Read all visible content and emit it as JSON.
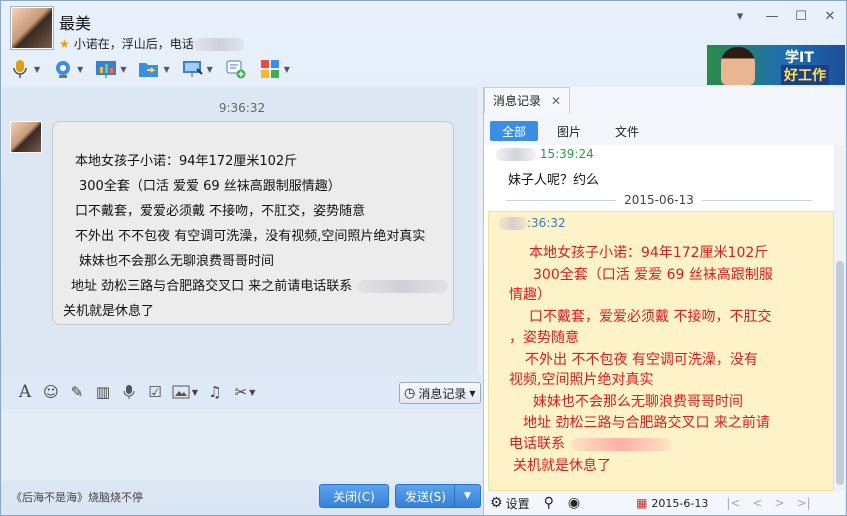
{
  "header": {
    "nickname": "最美",
    "signature": "小诺在，浮山后，电话"
  },
  "window_controls": {
    "dropdown": "▾",
    "minimize": "—",
    "maximize": "☐",
    "close": "✕"
  },
  "ad": {
    "line1": "学IT",
    "line2": "好工作"
  },
  "chat": {
    "timestamp": "9:36:32",
    "lines": [
      "本地女孩子小诺：94年172厘米102斤",
      "300全套（口活 爱爱 69 丝袜高跟制服情趣）",
      "口不戴套，爱爱必须戴 不接吻，不肛交，姿势随意",
      "不外出 不不包夜 有空调可洗澡，没有视频,空间照片绝对真实",
      "妹妹也不会那么无聊浪费哥哥时间",
      "地址 劲松三路与合肥路交叉口 来之前请电话联系",
      "关机就是休息了"
    ]
  },
  "input_toolbar": {
    "history_label": "消息记录"
  },
  "footer": {
    "music": "《后海不是海》烧脑烧不停",
    "close_label": "关闭(C)",
    "send_label": "发送(S)"
  },
  "history": {
    "tab_label": "消息记录",
    "filters": [
      "全部",
      "图片",
      "文件"
    ],
    "prev_time": "15:39:24",
    "prev_message": "妹子人呢？约么",
    "date_separator": "2015-06-13",
    "highlight_time": ":36:32",
    "lines": [
      "本地女孩子小诺：94年172厘米102斤",
      "300全套（口活 爱爱 69 丝袜高跟制服",
      "情趣）",
      "口不戴套，爱爱必须戴 不接吻，不肛交",
      "，姿势随意",
      "不外出 不不包夜 有空调可洗澡，没有",
      "视频,空间照片绝对真实",
      "妹妹也不会那么无聊浪费哥哥时间",
      "地址 劲松三路与合肥路交叉口 来之前请",
      "电话联系",
      "关机就是休息了"
    ],
    "settings_label": "设置",
    "date_value": "2015-6-13"
  },
  "colors": {
    "accent": "#3a8ee6",
    "highlight_bg": "#fdf2c8",
    "highlight_text": "#e01b1b",
    "time_green": "#2a9a48"
  }
}
